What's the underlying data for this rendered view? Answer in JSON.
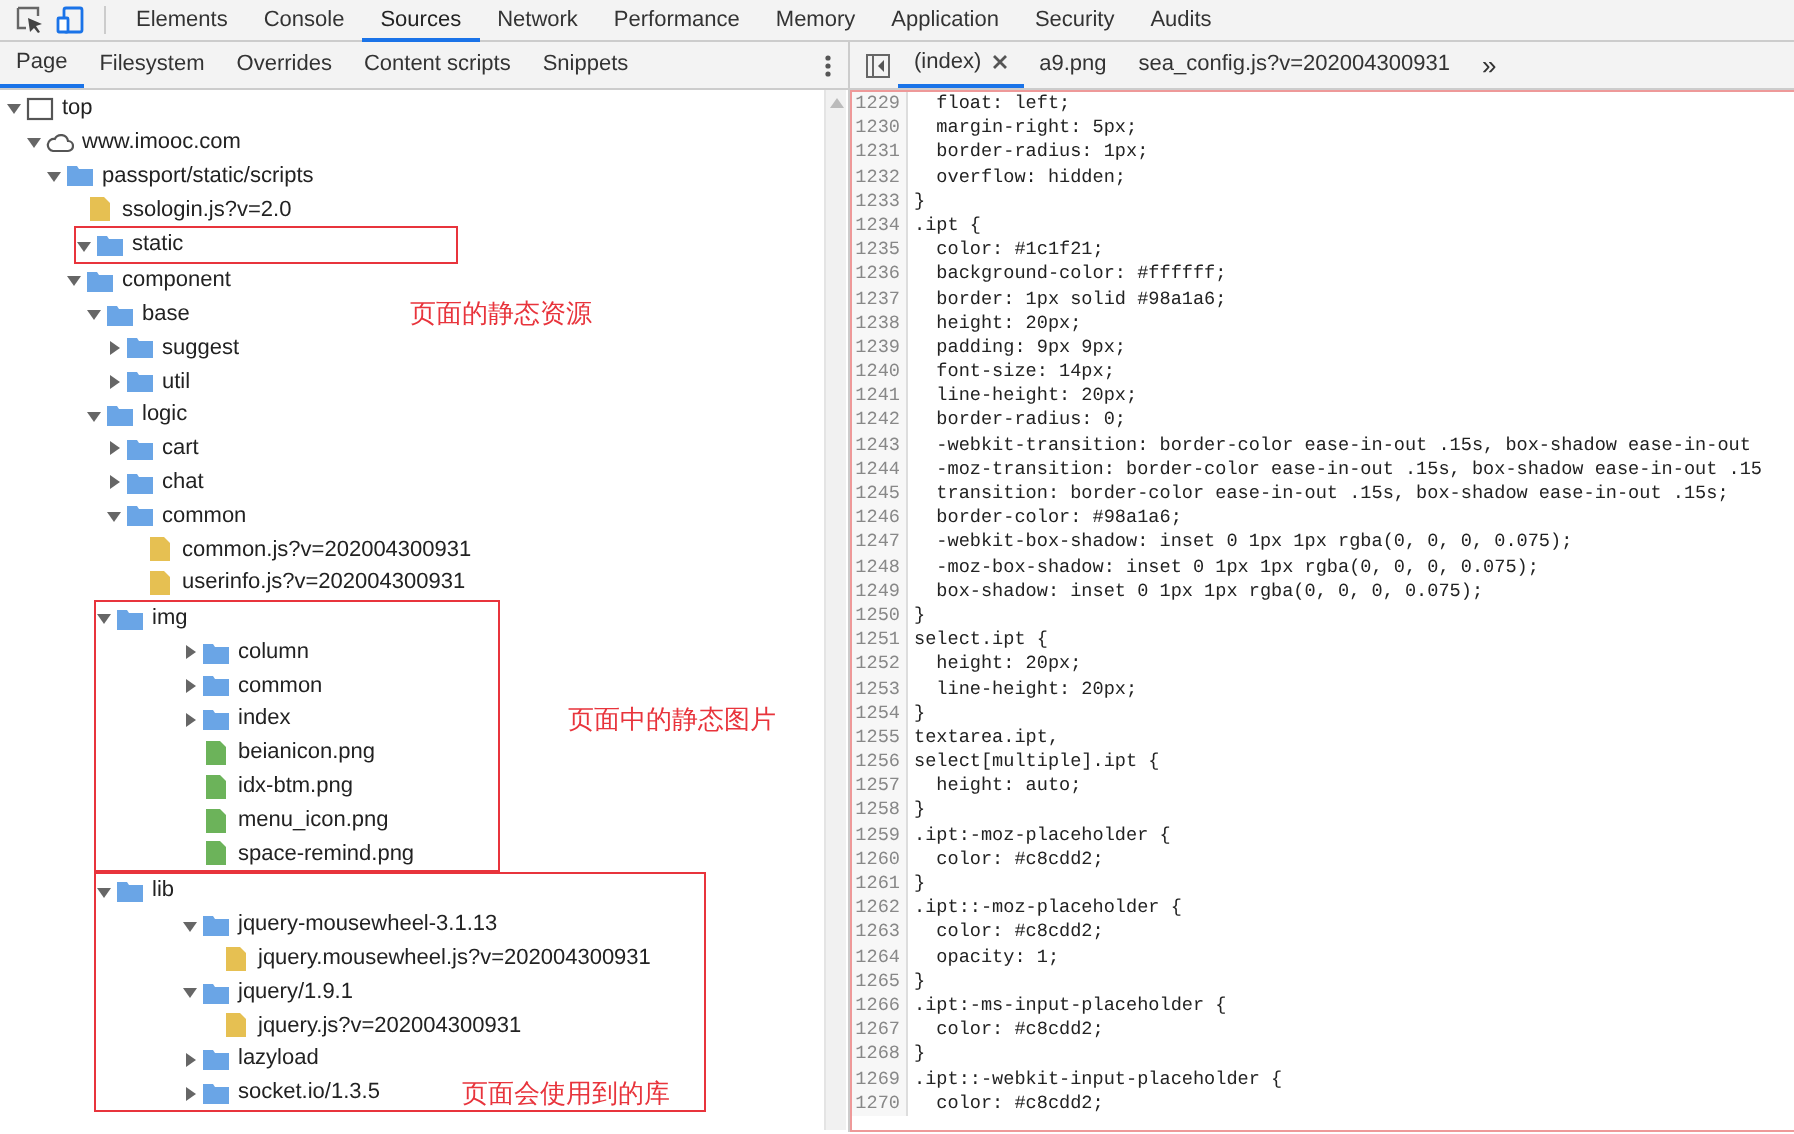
{
  "toolbar": {
    "tabs": [
      {
        "label": "Elements",
        "selected": false
      },
      {
        "label": "Console",
        "selected": false
      },
      {
        "label": "Sources",
        "selected": true
      },
      {
        "label": "Network",
        "selected": false
      },
      {
        "label": "Performance",
        "selected": false
      },
      {
        "label": "Memory",
        "selected": false
      },
      {
        "label": "Application",
        "selected": false
      },
      {
        "label": "Security",
        "selected": false
      },
      {
        "label": "Audits",
        "selected": false
      }
    ]
  },
  "navigator": {
    "tabs": [
      {
        "label": "Page",
        "selected": true
      },
      {
        "label": "Filesystem",
        "selected": false
      },
      {
        "label": "Overrides",
        "selected": false
      },
      {
        "label": "Content scripts",
        "selected": false
      },
      {
        "label": "Snippets",
        "selected": false
      }
    ],
    "tree": [
      {
        "kind": "frame",
        "label": "top",
        "expanded": true,
        "children": [
          {
            "kind": "domain",
            "label": "www.imooc.com",
            "expanded": true,
            "children": [
              {
                "kind": "folder",
                "label": "passport/static/scripts",
                "expanded": true,
                "children": [
                  {
                    "kind": "script",
                    "label": "ssologin.js?v=2.0"
                  }
                ]
              },
              {
                "kind": "folder",
                "label": "static",
                "expanded": true,
                "outlined_row": true,
                "children": [
                  {
                    "kind": "folder",
                    "label": "component",
                    "expanded": true,
                    "children": [
                      {
                        "kind": "folder",
                        "label": "base",
                        "expanded": true,
                        "note": "页面的静态资源",
                        "children": [
                          {
                            "kind": "folder",
                            "label": "suggest",
                            "expanded": false
                          },
                          {
                            "kind": "folder",
                            "label": "util",
                            "expanded": false
                          }
                        ]
                      },
                      {
                        "kind": "folder",
                        "label": "logic",
                        "expanded": true,
                        "children": [
                          {
                            "kind": "folder",
                            "label": "cart",
                            "expanded": false
                          },
                          {
                            "kind": "folder",
                            "label": "chat",
                            "expanded": false
                          },
                          {
                            "kind": "folder",
                            "label": "common",
                            "expanded": true,
                            "children": [
                              {
                                "kind": "script",
                                "label": "common.js?v=202004300931"
                              },
                              {
                                "kind": "script",
                                "label": "userinfo.js?v=202004300931"
                              }
                            ]
                          }
                        ]
                      }
                    ]
                  },
                  {
                    "kind": "folder",
                    "label": "img",
                    "expanded": true,
                    "outlined_group": true,
                    "children": [
                      {
                        "kind": "folder",
                        "label": "column",
                        "expanded": false
                      },
                      {
                        "kind": "folder",
                        "label": "common",
                        "expanded": false
                      },
                      {
                        "kind": "folder",
                        "label": "index",
                        "expanded": false,
                        "note": "页面中的静态图片"
                      },
                      {
                        "kind": "image",
                        "label": "beianicon.png"
                      },
                      {
                        "kind": "image",
                        "label": "idx-btm.png"
                      },
                      {
                        "kind": "image",
                        "label": "menu_icon.png"
                      },
                      {
                        "kind": "image",
                        "label": "space-remind.png"
                      }
                    ]
                  },
                  {
                    "kind": "folder",
                    "label": "lib",
                    "expanded": true,
                    "outlined_group": true,
                    "children": [
                      {
                        "kind": "folder",
                        "label": "jquery-mousewheel-3.1.13",
                        "expanded": true,
                        "children": [
                          {
                            "kind": "script",
                            "label": "jquery.mousewheel.js?v=202004300931"
                          }
                        ]
                      },
                      {
                        "kind": "folder",
                        "label": "jquery/1.9.1",
                        "expanded": true,
                        "children": [
                          {
                            "kind": "script",
                            "label": "jquery.js?v=202004300931"
                          }
                        ]
                      },
                      {
                        "kind": "folder",
                        "label": "lazyload",
                        "expanded": false
                      },
                      {
                        "kind": "folder",
                        "label": "socket.io/1.3.5",
                        "expanded": false,
                        "note": "页面会使用到的库"
                      }
                    ]
                  }
                ]
              }
            ]
          }
        ]
      }
    ]
  },
  "editor": {
    "tabs": [
      {
        "label": "(index)",
        "selected": true,
        "closable": true
      },
      {
        "label": "a9.png",
        "selected": false,
        "closable": false
      },
      {
        "label": "sea_config.js?v=202004300931",
        "selected": false,
        "closable": false
      }
    ],
    "overflow": "»",
    "lines": [
      {
        "number": "1229",
        "text": "  float: left;"
      },
      {
        "number": "1230",
        "text": "  margin-right: 5px;"
      },
      {
        "number": "1231",
        "text": "  border-radius: 1px;"
      },
      {
        "number": "1232",
        "text": "  overflow: hidden;"
      },
      {
        "number": "1233",
        "text": "}"
      },
      {
        "number": "1234",
        "text": ".ipt {"
      },
      {
        "number": "1235",
        "text": "  color: #1c1f21;"
      },
      {
        "number": "1236",
        "text": "  background-color: #ffffff;"
      },
      {
        "number": "1237",
        "text": "  border: 1px solid #98a1a6;"
      },
      {
        "number": "1238",
        "text": "  height: 20px;"
      },
      {
        "number": "1239",
        "text": "  padding: 9px 9px;"
      },
      {
        "number": "1240",
        "text": "  font-size: 14px;"
      },
      {
        "number": "1241",
        "text": "  line-height: 20px;"
      },
      {
        "number": "1242",
        "text": "  border-radius: 0;"
      },
      {
        "number": "1243",
        "text": "  -webkit-transition: border-color ease-in-out .15s, box-shadow ease-in-out"
      },
      {
        "number": "1244",
        "text": "  -moz-transition: border-color ease-in-out .15s, box-shadow ease-in-out .15"
      },
      {
        "number": "1245",
        "text": "  transition: border-color ease-in-out .15s, box-shadow ease-in-out .15s;"
      },
      {
        "number": "1246",
        "text": "  border-color: #98a1a6;"
      },
      {
        "number": "1247",
        "text": "  -webkit-box-shadow: inset 0 1px 1px rgba(0, 0, 0, 0.075);"
      },
      {
        "number": "1248",
        "text": "  -moz-box-shadow: inset 0 1px 1px rgba(0, 0, 0, 0.075);"
      },
      {
        "number": "1249",
        "text": "  box-shadow: inset 0 1px 1px rgba(0, 0, 0, 0.075);"
      },
      {
        "number": "1250",
        "text": "}"
      },
      {
        "number": "1251",
        "text": "select.ipt {"
      },
      {
        "number": "1252",
        "text": "  height: 20px;"
      },
      {
        "number": "1253",
        "text": "  line-height: 20px;"
      },
      {
        "number": "1254",
        "text": "}"
      },
      {
        "number": "1255",
        "text": "textarea.ipt,"
      },
      {
        "number": "1256",
        "text": "select[multiple].ipt {"
      },
      {
        "number": "1257",
        "text": "  height: auto;"
      },
      {
        "number": "1258",
        "text": "}"
      },
      {
        "number": "1259",
        "text": ".ipt:-moz-placeholder {"
      },
      {
        "number": "1260",
        "text": "  color: #c8cdd2;"
      },
      {
        "number": "1261",
        "text": "}"
      },
      {
        "number": "1262",
        "text": ".ipt::-moz-placeholder {"
      },
      {
        "number": "1263",
        "text": "  color: #c8cdd2;"
      },
      {
        "number": "1264",
        "text": "  opacity: 1;"
      },
      {
        "number": "1265",
        "text": "}"
      },
      {
        "number": "1266",
        "text": ".ipt:-ms-input-placeholder {"
      },
      {
        "number": "1267",
        "text": "  color: #c8cdd2;"
      },
      {
        "number": "1268",
        "text": "}"
      },
      {
        "number": "1269",
        "text": ".ipt::-webkit-input-placeholder {"
      },
      {
        "number": "1270",
        "text": "  color: #c8cdd2;"
      }
    ]
  }
}
